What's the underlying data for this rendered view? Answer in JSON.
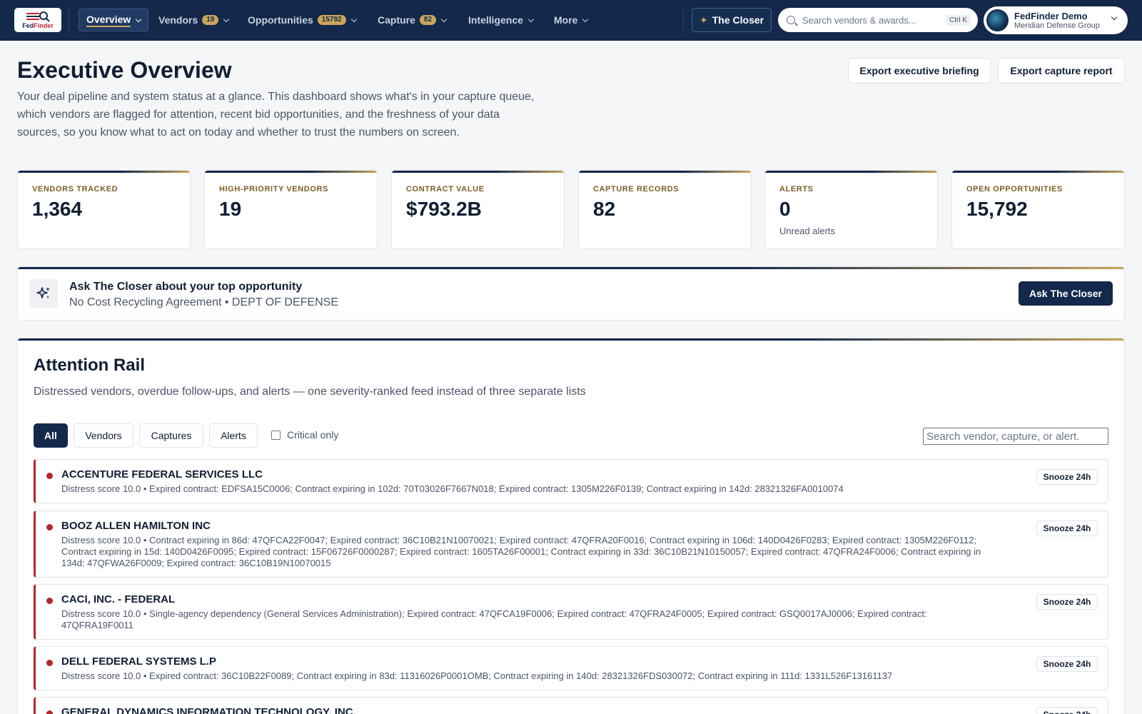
{
  "nav": {
    "logo_text_a": "Fed",
    "logo_text_b": "Finder",
    "items": [
      {
        "label": "Overview"
      },
      {
        "label": "Vendors",
        "badge": "19"
      },
      {
        "label": "Opportunities",
        "badge": "15792"
      },
      {
        "label": "Capture",
        "badge": "82"
      },
      {
        "label": "Intelligence"
      },
      {
        "label": "More"
      }
    ],
    "closer_label": "The Closer",
    "search_placeholder": "Search vendors & awards...",
    "search_shortcut": "Ctrl K",
    "user_name": "FedFinder Demo",
    "user_org": "Meridian Defense Group"
  },
  "header": {
    "title": "Executive Overview",
    "description": "Your deal pipeline and system status at a glance. This dashboard shows what's in your capture queue, which vendors are flagged for attention, recent bid opportunities, and the freshness of your data sources, so you know what to act on today and whether to trust the numbers on screen.",
    "export_briefing": "Export executive briefing",
    "export_capture": "Export capture report"
  },
  "stats": [
    {
      "label": "VENDORS TRACKED",
      "value": "1,364",
      "sub": ""
    },
    {
      "label": "HIGH-PRIORITY VENDORS",
      "value": "19",
      "sub": ""
    },
    {
      "label": "CONTRACT VALUE",
      "value": "$793.2B",
      "sub": ""
    },
    {
      "label": "CAPTURE RECORDS",
      "value": "82",
      "sub": ""
    },
    {
      "label": "ALERTS",
      "value": "0",
      "sub": "Unread alerts"
    },
    {
      "label": "OPEN OPPORTUNITIES",
      "value": "15,792",
      "sub": ""
    }
  ],
  "ask": {
    "title": "Ask The Closer about your top opportunity",
    "subtitle": "No Cost Recycling Agreement • DEPT OF DEFENSE",
    "button": "Ask The Closer"
  },
  "rail": {
    "title": "Attention Rail",
    "description": "Distressed vendors, overdue follow-ups, and alerts — one severity-ranked feed instead of three separate lists",
    "filters": [
      "All",
      "Vendors",
      "Captures",
      "Alerts"
    ],
    "critical_label": "Critical only",
    "search_placeholder": "Search vendor, capture, or alert.",
    "snooze_label": "Snooze 24h",
    "items": [
      {
        "name": "ACCENTURE FEDERAL SERVICES LLC",
        "detail": "Distress score 10.0 • Expired contract: EDFSA15C0006; Contract expiring in 102d: 70T03026F7667N018; Expired contract: 1305M226F0139; Contract expiring in 142d: 28321326FA0010074"
      },
      {
        "name": "BOOZ ALLEN HAMILTON INC",
        "detail": "Distress score 10.0 • Contract expiring in 86d: 47QFCA22F0047; Expired contract: 36C10B21N10070021; Expired contract: 47QFRA20F0016; Contract expiring in 106d: 140D0426F0283; Expired contract: 1305M226F0112; Contract expiring in 15d: 140D0426F0095; Expired contract: 15F06726F0000287; Expired contract: 1605TA26F00001; Contract expiring in 33d: 36C10B21N10150057; Expired contract: 47QFRA24F0006; Contract expiring in 134d: 47QFWA26F0009; Expired contract: 36C10B19N10070015"
      },
      {
        "name": "CACI, INC. - FEDERAL",
        "detail": "Distress score 10.0 • Single-agency dependency (General Services Administration); Expired contract: 47QFCA19F0006; Expired contract: 47QFRA24F0005; Expired contract: GSQ0017AJ0006; Expired contract: 47QFRA19F0011"
      },
      {
        "name": "DELL FEDERAL SYSTEMS L.P",
        "detail": "Distress score 10.0 • Expired contract: 36C10B22F0089; Contract expiring in 83d: 11316026P0001OMB; Contract expiring in 140d: 28321326FDS030072; Contract expiring in 111d: 1331L526F13161137"
      },
      {
        "name": "GENERAL DYNAMICS INFORMATION TECHNOLOGY, INC.",
        "detail": ""
      }
    ]
  }
}
